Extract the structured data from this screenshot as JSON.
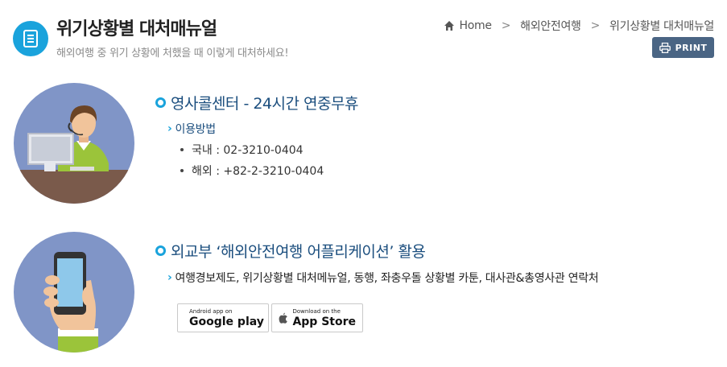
{
  "header": {
    "title": "위기상황별 대처매뉴얼",
    "subtitle": "해외여행 중 위기 상황에 처했을 때 이렇게 대처하세요!",
    "icon": "document-list-icon"
  },
  "breadcrumb": {
    "items": [
      "Home",
      "해외안전여행",
      "위기상황별 대처매뉴얼"
    ],
    "separator": ">"
  },
  "print_button": {
    "label": "PRINT",
    "icon": "printer-icon"
  },
  "sections": [
    {
      "heading": "영사콜센터  -  24시간 연중무휴",
      "sub_heading": "이용방법",
      "bullets": [
        "국내 : 02-3210-0404",
        "해외 : +82-2-3210-0404"
      ],
      "illustration": "call-center-operator-illustration"
    },
    {
      "heading": "외교부 ‘해외안전여행 어플리케이션’ 활용",
      "sub_heading": "여행경보제도, 위기상황별 대처메뉴얼, 동행, 좌충우돌 상황별 카툰, 대사관&총영사관 연락처",
      "illustration": "hand-holding-smartphone-illustration",
      "stores": [
        {
          "small": "Android app on",
          "big": "Google play",
          "icon": "google-play-icon"
        },
        {
          "small": "Download on the",
          "big": "App Store",
          "icon": "apple-icon"
        }
      ]
    }
  ],
  "colors": {
    "accent": "#1aa3dc",
    "heading": "#1b4e7e",
    "print_button": "#4a6584",
    "illustration_bg": "#8095c7"
  }
}
